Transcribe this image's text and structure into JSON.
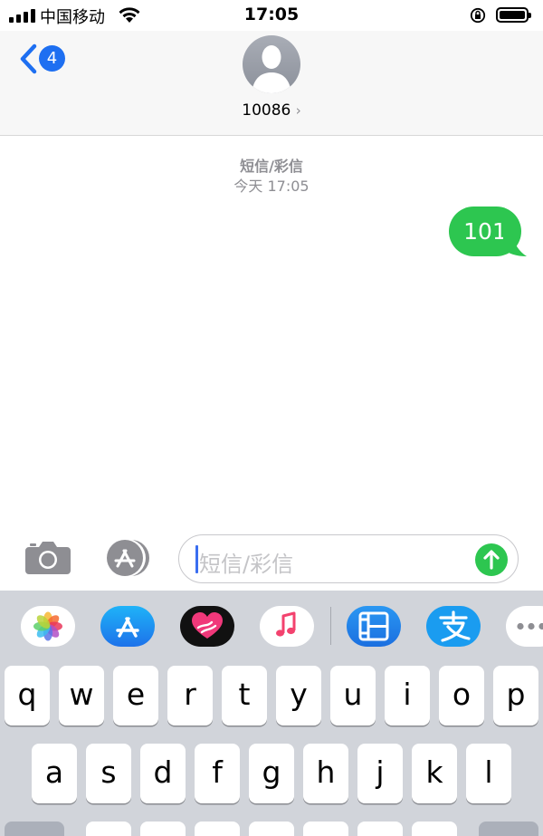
{
  "status": {
    "carrier": "中国移动",
    "time": "17:05"
  },
  "header": {
    "back_badge": "4",
    "contact": "10086",
    "contact_chevron": "›"
  },
  "conversation": {
    "service_label": "短信/彩信",
    "timestamp": "今天 17:05",
    "messages": [
      {
        "direction": "outgoing",
        "text": "101"
      }
    ]
  },
  "composer": {
    "placeholder": "短信/彩信"
  },
  "app_strip": [
    "photos-app",
    "app-store-app",
    "digital-touch-app",
    "music-app",
    "video-app",
    "alipay-app",
    "more-apps"
  ],
  "keyboard": {
    "row1": [
      "q",
      "w",
      "e",
      "r",
      "t",
      "y",
      "u",
      "i",
      "o",
      "p"
    ],
    "row2": [
      "a",
      "s",
      "d",
      "f",
      "g",
      "h",
      "j",
      "k",
      "l"
    ]
  },
  "colors": {
    "imessage_blue": "#1e6ff1",
    "sms_green": "#2dc650",
    "keyboard_bg": "#d1d4da"
  }
}
